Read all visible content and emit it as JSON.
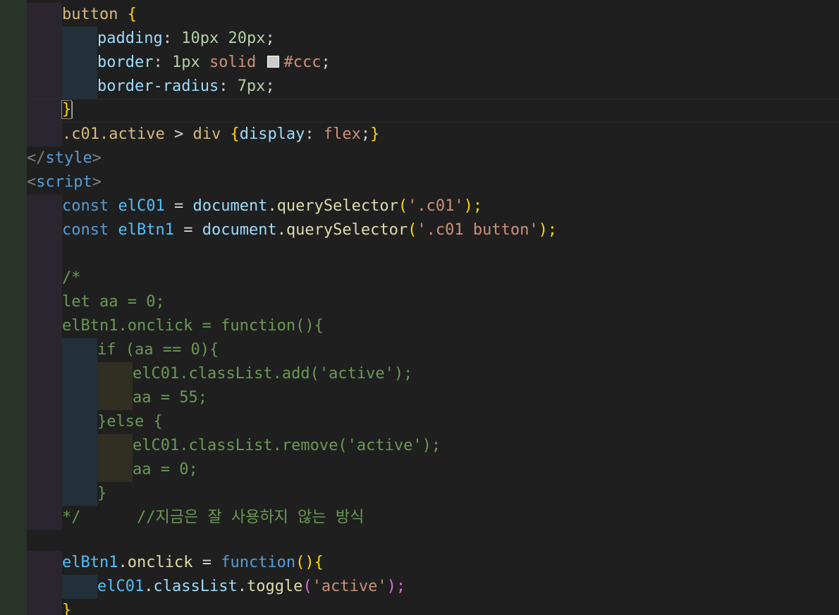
{
  "editor": {
    "lines": {
      "l1": {
        "t1": "button",
        "t2": " ",
        "t3": "{"
      },
      "l2": {
        "t1": "padding",
        "t2": ": ",
        "t3": "10px",
        "t4": " ",
        "t5": "20px",
        "t6": ";"
      },
      "l3": {
        "t1": "border",
        "t2": ": ",
        "t3": "1px",
        "t4": " solid ",
        "swatch_color": "#cccccc",
        "t5": "#ccc",
        "t6": ";"
      },
      "l4": {
        "t1": "border-radius",
        "t2": ": ",
        "t3": "7px",
        "t4": ";"
      },
      "l5": {
        "t1": "}"
      },
      "l6": {
        "t1": ".c01.active",
        "t2": " > ",
        "t3": "div",
        "t4": " ",
        "t5": "{",
        "t6": "display",
        "t7": ": ",
        "t8": "flex",
        "t9": ";",
        "t10": "}"
      },
      "l7": {
        "t1": "</",
        "t2": "style",
        "t3": ">"
      },
      "l8": {
        "t1": "<",
        "t2": "script",
        "t3": ">"
      },
      "l9": {
        "t1": "const",
        "t2": " ",
        "t3": "elC01",
        "t4": " = ",
        "t5": "document",
        "t6": ".",
        "t7": "querySelector",
        "t8": "(",
        "t9": "'.c01'",
        "t10": ");"
      },
      "l10": {
        "t1": "const",
        "t2": " ",
        "t3": "elBtn1",
        "t4": " = ",
        "t5": "document",
        "t6": ".",
        "t7": "querySelector",
        "t8": "(",
        "t9": "'.c01 button'",
        "t10": ");"
      },
      "l12": {
        "t1": "/*"
      },
      "l13": {
        "t1": "let aa = 0;"
      },
      "l14": {
        "t1": "elBtn1.onclick = function(){"
      },
      "l15": {
        "t1": "if (aa == 0){"
      },
      "l16": {
        "t1": "elC01.classList.add('active');"
      },
      "l17": {
        "t1": "aa = 55;"
      },
      "l18": {
        "t1": "}else {"
      },
      "l19": {
        "t1": "elC01.classList.remove('active');"
      },
      "l20": {
        "t1": "aa = 0;"
      },
      "l21": {
        "t1": "}"
      },
      "l22": {
        "t1": "*/",
        "t2": "      ",
        "t3": "//지금은 잘 사용하지 않는 방식"
      },
      "l24": {
        "t1": "elBtn1",
        "t2": ".",
        "t3": "onclick",
        "t4": " = ",
        "t5": "function",
        "t6": "()",
        "t7": "{"
      },
      "l25": {
        "t1": "elC01",
        "t2": ".",
        "t3": "classList",
        "t4": ".",
        "t5": "toggle",
        "t6": "(",
        "t7": "'active'",
        "t8": ");"
      },
      "l26": {
        "t1": "}"
      }
    }
  }
}
